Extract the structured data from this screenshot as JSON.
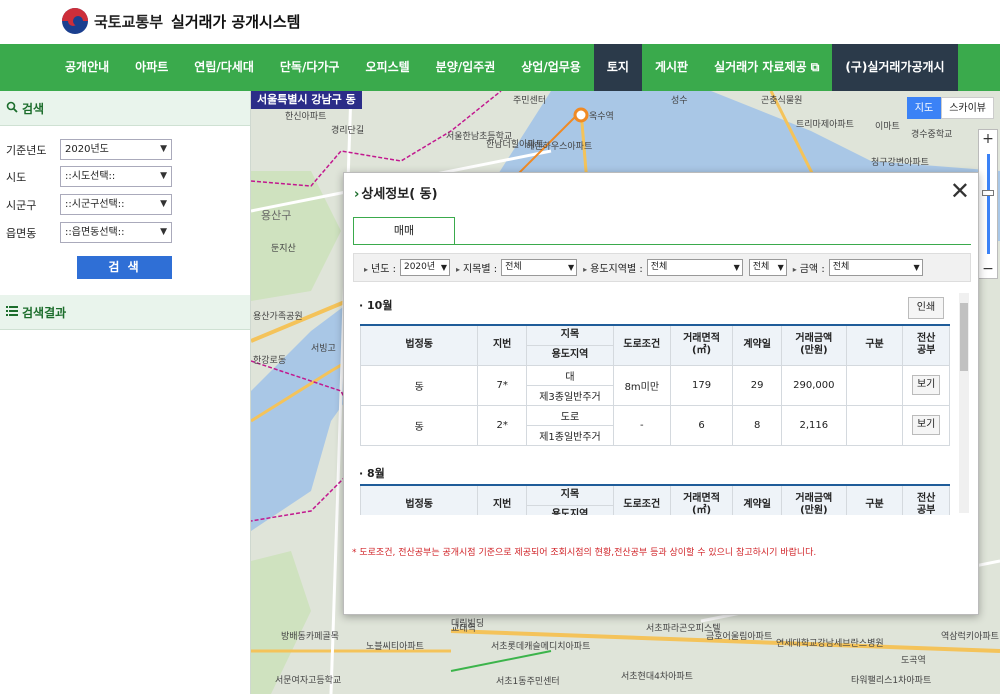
{
  "header": {
    "ministry": "국토교통부",
    "system": "실거래가 공개시스템"
  },
  "nav": {
    "items": [
      "공개안내",
      "아파트",
      "연립/다세대",
      "단독/다가구",
      "오피스텔",
      "분양/입주권",
      "상업/업무용",
      "토지",
      "게시판",
      "실거래가 자료제공 ⧉",
      "(구)실거래가공개시"
    ],
    "active_index": 7
  },
  "search": {
    "title": "검색",
    "fields": [
      {
        "label": "기준년도",
        "value": "2020년도"
      },
      {
        "label": "시도",
        "value": "::시도선택::"
      },
      {
        "label": "시군구",
        "value": "::시군구선택::"
      },
      {
        "label": "읍면동",
        "value": "::읍면동선택::"
      }
    ],
    "button": "검 색",
    "results_title": "검색결과"
  },
  "map": {
    "location": "서울특별시 강남구          동",
    "type_map": "지도",
    "type_sky": "스카이뷰",
    "labels": [
      "주민센터",
      "옥수역",
      "성수",
      "곤충식물원",
      "한신아파트",
      "경리단길",
      "서울한남초등학교",
      "한남더힐아파트",
      "헤렌하우스아파트",
      "트리마제아파트",
      "이마트",
      "경수중학교",
      "청구강변아파트",
      "용산구",
      "둔지산",
      "용산가족공원",
      "서빙고",
      "한강로동",
      "서초파라곤오피스텔",
      "금호어울림아파트",
      "연세대학교강남세브란스병원",
      "역삼럭키아파트",
      "도곡역",
      "교대역",
      "서초롯데캐슬메디치아파트",
      "서초1동주민센터",
      "서초현대4차아파트",
      "타워팰리스1차아파트",
      "방배동카페골목",
      "서문여자고등학교",
      "노블씨티아파트",
      "대림빌딩"
    ]
  },
  "modal": {
    "title": "상세정보(        동)",
    "tab": "매매",
    "filters": {
      "year_label": "년도 :",
      "year_value": "2020년",
      "jimok_label": "지목별 :",
      "jimok_value": "전체",
      "yongdo_label": "용도지역별 :",
      "yongdo_value": "전체",
      "yongdo_value2": "전체",
      "amount_label": "금액 :",
      "amount_value": "전체"
    },
    "print": "인쇄",
    "months": [
      {
        "month": "10월",
        "rows": [
          {
            "dong": "동",
            "jibun": "7*",
            "jimok": "대",
            "yongdo": "제3종일반주거",
            "road": "8m미만",
            "area": "179",
            "day": "29",
            "price": "290,000",
            "type": "",
            "view": "보기"
          },
          {
            "dong": "동",
            "jibun": "2*",
            "jimok": "도로",
            "yongdo": "제1종일반주거",
            "road": "-",
            "area": "6",
            "day": "8",
            "price": "2,116",
            "type": "",
            "view": "보기"
          }
        ]
      },
      {
        "month": "8월",
        "rows": []
      }
    ],
    "headers": {
      "dong": "법정동",
      "jibun": "지번",
      "jimok": "지목",
      "yongdo": "용도지역",
      "road": "도로조건",
      "area": "거래면적\n(㎡)",
      "day": "계약일",
      "price": "거래금액\n(만원)",
      "type": "구분",
      "jeonsan": "전산\n공부"
    },
    "note": "* 도로조건, 전산공부는 공개시점 기준으로 제공되어 조회시점의 현황,전산공부 등과 상이할 수 있으니 참고하시기 바랍니다."
  }
}
